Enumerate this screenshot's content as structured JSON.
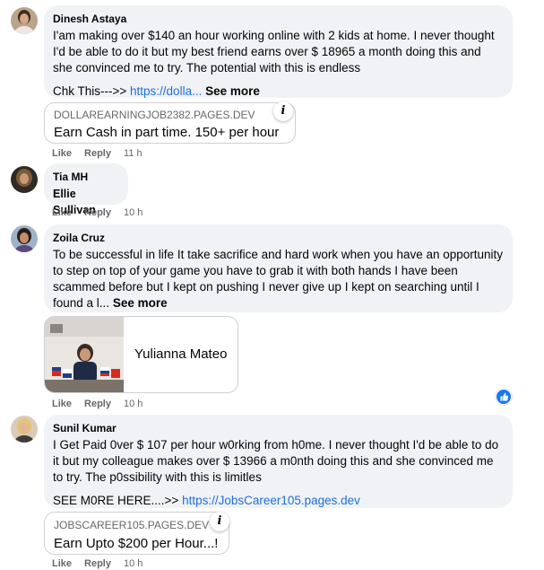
{
  "comments": [
    {
      "author": "Dinesh Astaya",
      "text": "I'am making over $140 an hour working online with 2 kids at home. I never thought I'd be able to do it but my best friend earns over $ 18965 a month doing this and she convinced me to try. The potential with this is endless",
      "link_prefix": "Chk This--->> ",
      "link_text": "https://dolla...",
      "see_more": "See more",
      "card_domain": "DOLLAREARNINGJOB2382.PAGES.DEV",
      "card_title": "Earn Cash in part time. 150+ per hour",
      "like": "Like",
      "reply": "Reply",
      "time": "11 h"
    },
    {
      "author": "Tia MH",
      "text": "Ellie Sullivan",
      "like": "Like",
      "reply": "Reply",
      "time": "10 h"
    },
    {
      "author": "Zoila Cruz",
      "text": "To be successful in life It take sacrifice and hard work when you have an opportunity to step on top of your game you have to grab it with both hands I have been scammed before but I kept on pushing I never give up I kept on searching until I found a l...",
      "see_more": "See more",
      "card_title": "Yulianna Mateo",
      "like": "Like",
      "reply": "Reply",
      "time": "10 h"
    },
    {
      "author": "Sunil Kumar",
      "text": "I Get Paid 0ver $ 107 per hour w0rking from h0me. I never thought I'd be able to do it but my colleague makes over $ 13966 a m0nth doing this and she convinced me to try. The p0ssibility with this is limitles",
      "link_prefix": "SEE M0RE HERE....>> ",
      "link_text": "https://JobsCareer105.pages.dev",
      "card_domain": "JOBSCAREER105.PAGES.DEV",
      "card_title": "Earn Upto $200 per Hour...!",
      "like": "Like",
      "reply": "Reply",
      "time": "10 h"
    }
  ],
  "icons": {
    "info": "i",
    "reaction": "thumbs-up-icon"
  },
  "colors": {
    "bubble": "#f0f2f5",
    "link": "#216fdb",
    "meta": "#65676b",
    "reaction": "#1877f2"
  }
}
